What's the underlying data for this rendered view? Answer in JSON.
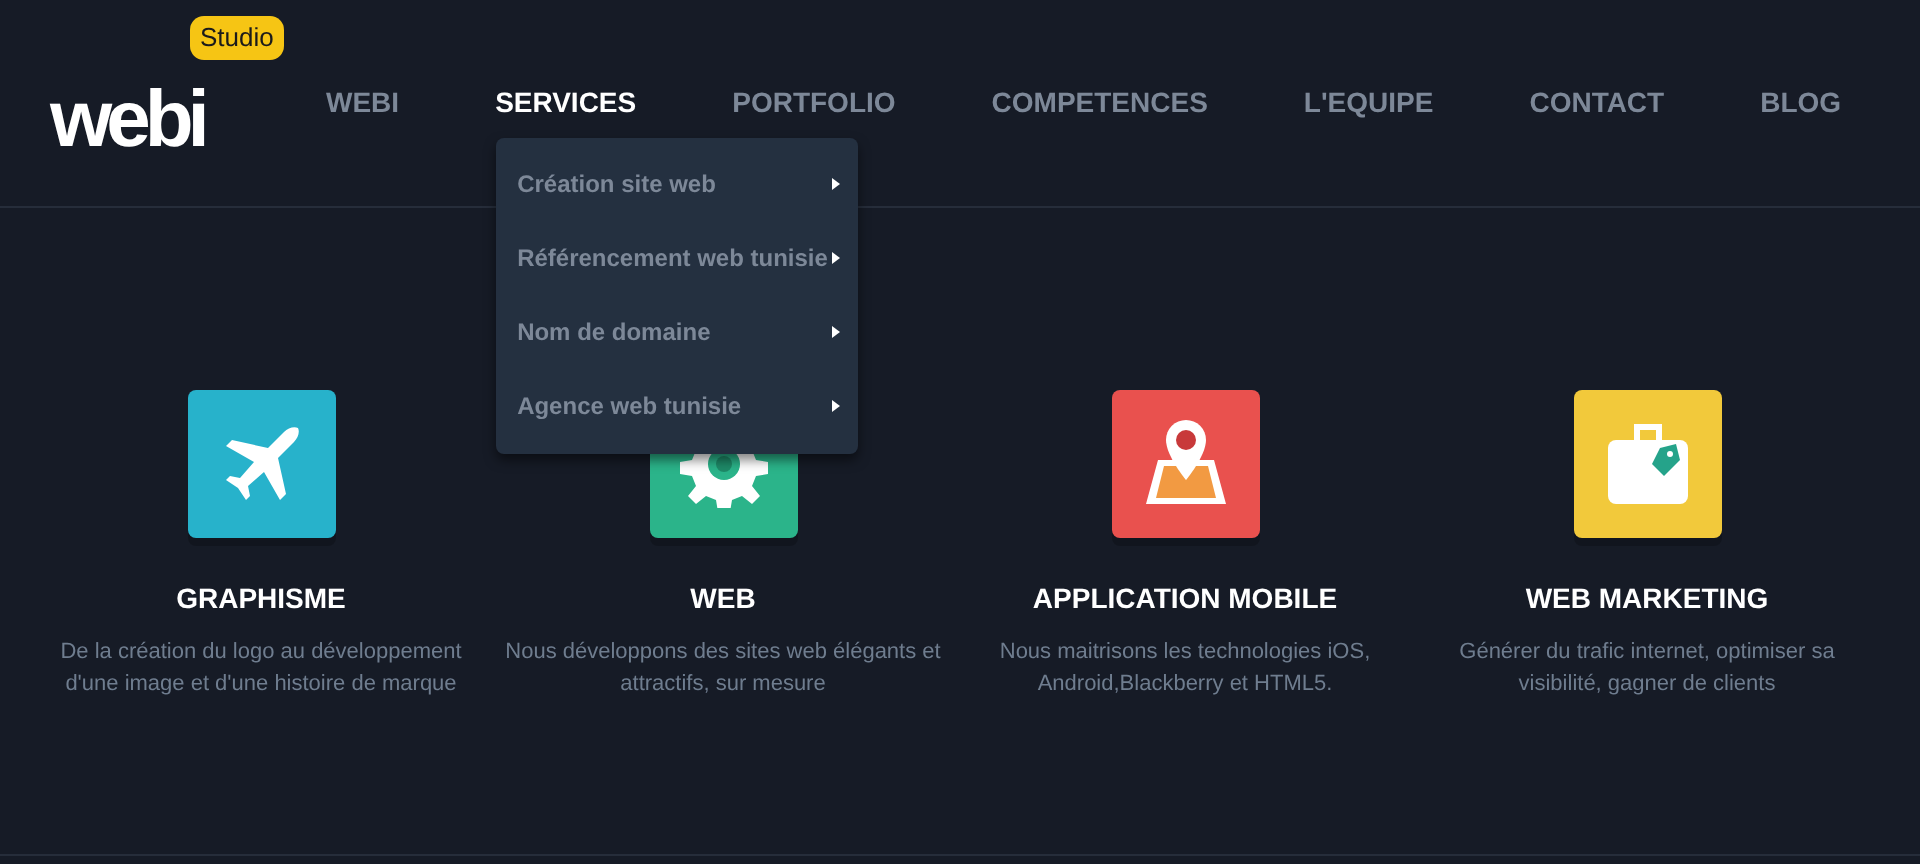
{
  "logo": {
    "text": "webi",
    "badge": "Studio"
  },
  "nav": [
    {
      "label": "WEBI",
      "selected": false
    },
    {
      "label": "SERVICES",
      "selected": true,
      "submenu": [
        "Création site web",
        "Référencement web tunisie",
        "Nom de domaine",
        "Agence web tunisie"
      ]
    },
    {
      "label": "PORTFOLIO",
      "selected": false
    },
    {
      "label": "COMPETENCES",
      "selected": false
    },
    {
      "label": "L'EQUIPE",
      "selected": false
    },
    {
      "label": "CONTACT",
      "selected": false
    },
    {
      "label": "BLOG",
      "selected": false
    }
  ],
  "services": [
    {
      "kind": "plane",
      "color": "#27b2cb",
      "title": "GRAPHISME",
      "text": "De la création du logo au développement d'une image et d'une histoire de marque"
    },
    {
      "kind": "gear",
      "color": "#2bb48a",
      "title": "WEB",
      "text": "Nous développons des sites web élégants et attractifs, sur mesure"
    },
    {
      "kind": "map",
      "color": "#e9514e",
      "title": "APPLICATION MOBILE",
      "text": "Nous maitrisons les technologies iOS, Android,Blackberry et HTML5."
    },
    {
      "kind": "suitcase",
      "color": "#f2c93b",
      "title": "WEB MARKETING",
      "text": "Générer du trafic internet, optimiser sa visibilité, gagner de clients"
    }
  ]
}
